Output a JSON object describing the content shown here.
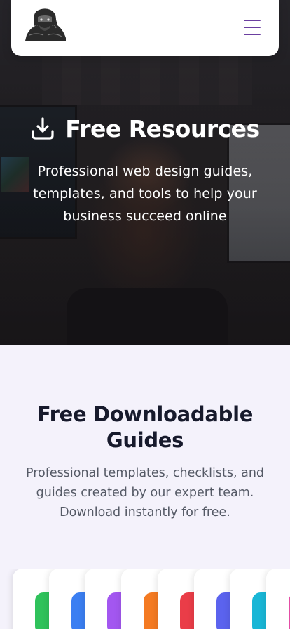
{
  "header": {
    "logo_icon": "gorilla-logo-icon",
    "menu_icon": "hamburger-menu-icon",
    "menu_color": "#6b3fa0"
  },
  "hero": {
    "icon": "download-icon",
    "title": "Free Resources",
    "subtitle": "Professional web design guides, templates, and tools to help your business succeed online"
  },
  "section": {
    "title": "Free Downloadable Guides",
    "subtitle": "Professional templates, checklists, and guides created by our expert team. Download instantly for free."
  },
  "guide_cards": [
    {
      "accent": "#2fc25b"
    },
    {
      "accent": "#3b7ff2"
    },
    {
      "accent": "#a357f0"
    },
    {
      "accent": "#f47a22"
    },
    {
      "accent": "#ea3d48"
    },
    {
      "accent": "#5b63ee"
    },
    {
      "accent": "#19b6d6"
    },
    {
      "accent": "#e44da5"
    }
  ]
}
